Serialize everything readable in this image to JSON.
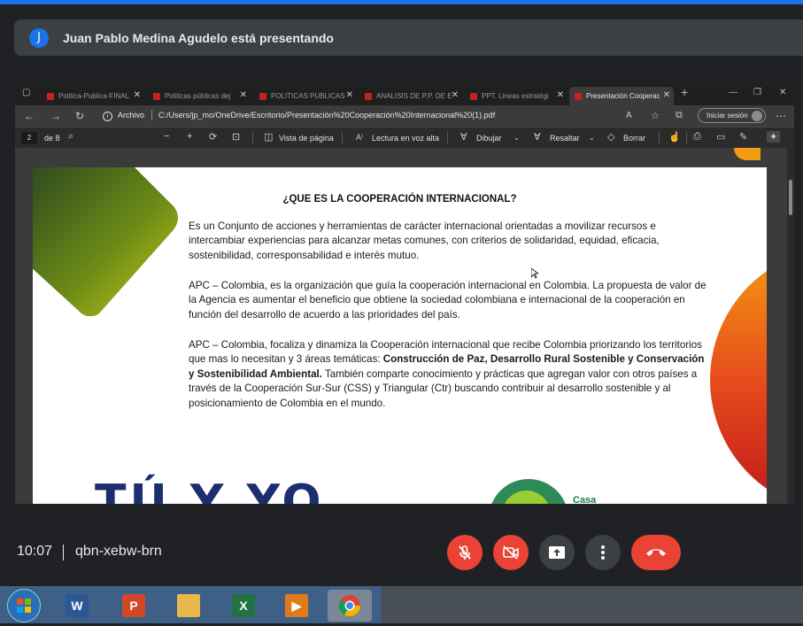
{
  "meet": {
    "presenter_initial": "J",
    "presenter_text": "Juan Pablo Medina Agudelo está presentando",
    "time": "10:07",
    "meeting_code": "qbn-xebw-brn"
  },
  "browser": {
    "tabs": [
      {
        "label": "Politica-Publica-FINAL"
      },
      {
        "label": "Politicas públicas dej"
      },
      {
        "label": "POLITICAS PUBLICAS"
      },
      {
        "label": "ANALISIS DE P.P. DE E"
      },
      {
        "label": "PPT. Lineas estratégi"
      },
      {
        "label": "Presentación Cooperac"
      }
    ],
    "address_label": "Archivo",
    "url": "C:/Users/jp_mo/OneDrive/Escritorio/Presentación%20Cooperación%20Internacional%20(1).pdf",
    "signin_label": "Iniciar sesión"
  },
  "pdf_toolbar": {
    "page_current": "2",
    "page_total": "de 8",
    "page_view": "Vista de página",
    "read_aloud": "Lectura en voz alta",
    "draw": "Dibujar",
    "highlight": "Resaltar",
    "erase": "Borrar"
  },
  "slide": {
    "title": "¿QUE ES LA COOPERACIÓN INTERNACIONAL?",
    "p1": "Es un Conjunto de acciones y herramientas de carácter internacional orientadas a movilizar recursos e intercambiar experiencias para alcanzar metas comunes, con criterios de solidaridad, equidad, eficacia, sostenibilidad, corresponsabilidad e interés mutuo.",
    "p2": "APC – Colombia, es la organización que guía la cooperación internacional en Colombia. La propuesta de valor de la Agencia es aumentar el beneficio que obtiene la sociedad colombiana e internacional de la cooperación en función del desarrollo de acuerdo a las prioridades del país.",
    "p3_a": "APC – Colombia, focaliza y dinamiza la Cooperación internacional que recibe Colombia priorizando los territorios que mas lo necesitan y 3 áreas temáticas: ",
    "p3_bold": "Construcción de Paz, Desarrollo Rural Sostenible y Conservación y Sostenibilidad Ambiental.",
    "p3_b": " También comparte conocimiento y prácticas que agregan valor con otros países a través de la Cooperación Sur-Sur (CSS) y Triangular (Ctr) buscando contribuir al desarrollo sostenible y al posicionamiento de Colombia en el mundo.",
    "logo_left_text": "TÚ Y YO",
    "logo_right_text": "Casa"
  },
  "icons": [
    "microphone-off-icon",
    "camera-off-icon",
    "present-screen-icon",
    "more-options-icon",
    "hang-up-icon"
  ],
  "colors": {
    "meet_red": "#ea4335",
    "meet_bg": "#202124",
    "accent": "#1a73e8"
  }
}
